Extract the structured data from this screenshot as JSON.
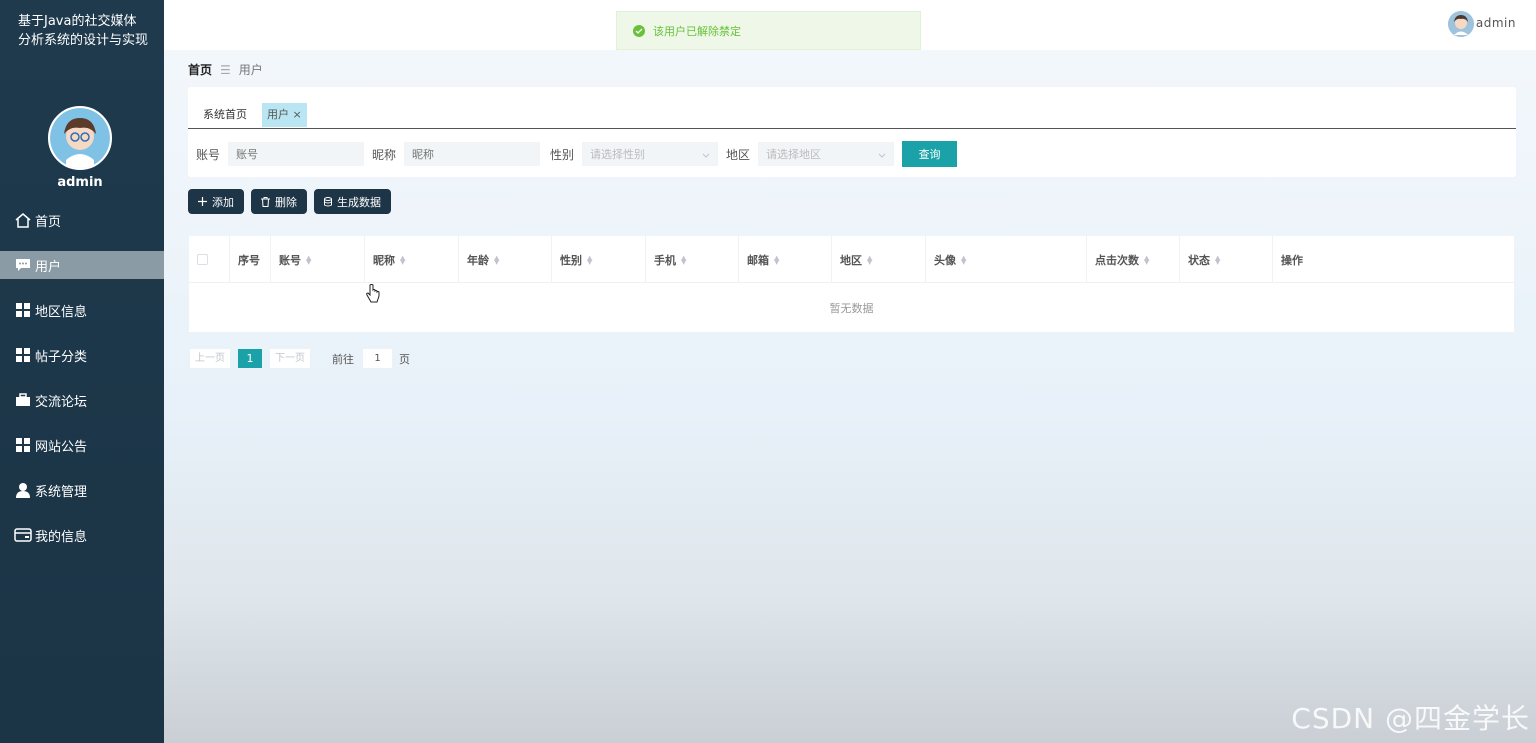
{
  "app": {
    "title": "基于Java的社交媒体分析系统的设计与实现",
    "username": "admin"
  },
  "sidebar": {
    "items": [
      {
        "label": "首页",
        "icon": "home-icon",
        "active": false
      },
      {
        "label": "用户",
        "icon": "chat-icon",
        "active": true
      },
      {
        "label": "地区信息",
        "icon": "grid-icon",
        "active": false
      },
      {
        "label": "帖子分类",
        "icon": "grid-icon",
        "active": false
      },
      {
        "label": "交流论坛",
        "icon": "briefcase-icon",
        "active": false
      },
      {
        "label": "网站公告",
        "icon": "grid-icon",
        "active": false
      },
      {
        "label": "系统管理",
        "icon": "person-icon",
        "active": false
      },
      {
        "label": "我的信息",
        "icon": "card-icon",
        "active": false
      }
    ]
  },
  "topbar": {
    "username": "admin"
  },
  "toast": {
    "message": "该用户已解除禁定",
    "type": "success",
    "color": "#67c23a"
  },
  "breadcrumb": {
    "home": "首页",
    "separator": "☰",
    "current": "用户"
  },
  "tabs": [
    {
      "label": "系统首页",
      "active": false
    },
    {
      "label": "用户 ×",
      "active": true
    }
  ],
  "filters": {
    "account": {
      "label": "账号",
      "placeholder": "账号"
    },
    "nickname": {
      "label": "昵称",
      "placeholder": "昵称"
    },
    "gender": {
      "label": "性别",
      "placeholder": "请选择性别"
    },
    "region": {
      "label": "地区",
      "placeholder": "请选择地区"
    },
    "query_label": "查询"
  },
  "actions": {
    "add": "添加",
    "delete": "删除",
    "generate": "生成数据"
  },
  "table": {
    "columns": [
      "序号",
      "账号",
      "昵称",
      "年龄",
      "性别",
      "手机",
      "邮箱",
      "地区",
      "头像",
      "点击次数",
      "状态",
      "操作"
    ],
    "empty_text": "暂无数据"
  },
  "pagination": {
    "prev": "上一页",
    "current": "1",
    "next": "下一页",
    "goto": "前往",
    "goto_value": "1",
    "page_unit": "页"
  },
  "watermark": "CSDN @四金学长",
  "colors": {
    "sidebar": "#1f3a4d",
    "accent": "#1aa2a8",
    "button": "#1e3547"
  }
}
